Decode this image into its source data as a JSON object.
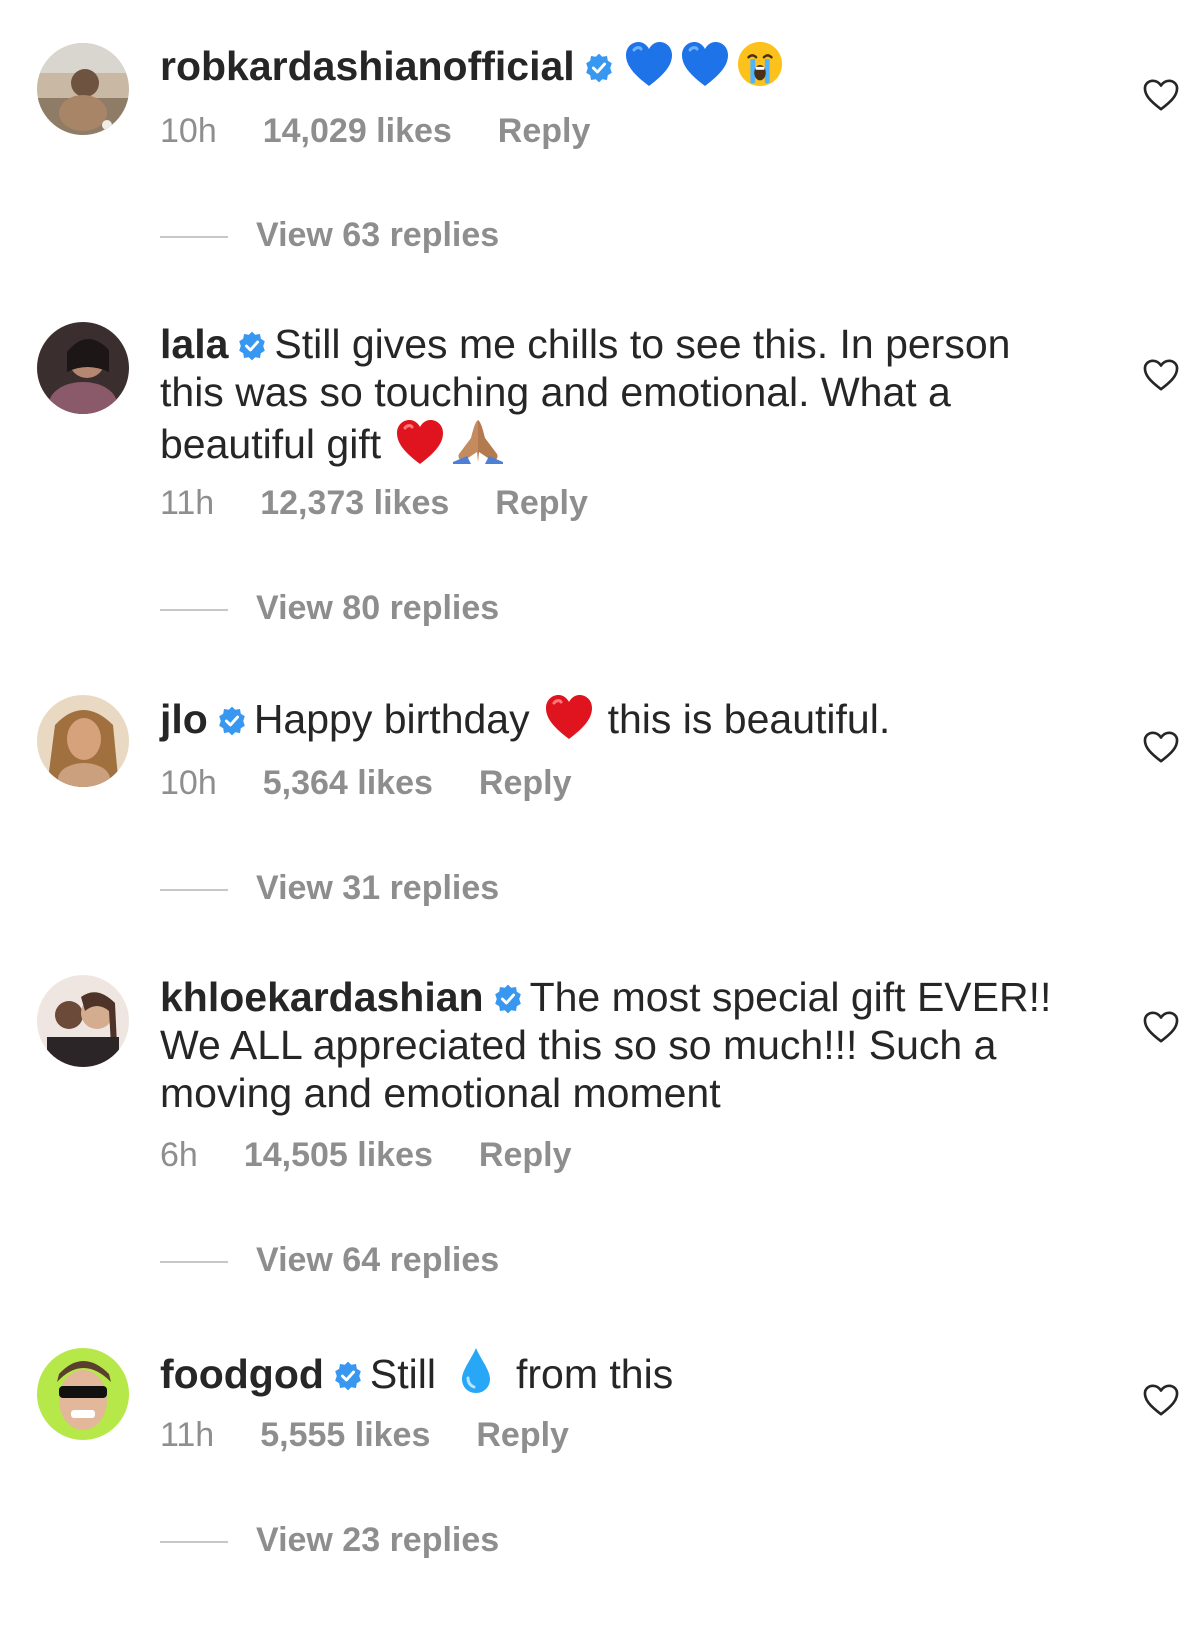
{
  "comments": [
    {
      "username": "robkardashianofficial",
      "text": "",
      "emoji": [
        "blue-heart",
        "blue-heart",
        "crying-face"
      ],
      "time": "10h",
      "likes": "14,029 likes",
      "reply": "Reply",
      "view_replies": "View 63 replies"
    },
    {
      "username": "lala",
      "text": "Still gives me chills to see this. In person this was so touching and emotional. What a beautiful gift",
      "emoji": [
        "red-heart",
        "folded-hands"
      ],
      "time": "11h",
      "likes": "12,373 likes",
      "reply": "Reply",
      "view_replies": "View 80 replies"
    },
    {
      "username": "jlo",
      "text_before": "Happy birthday",
      "emoji": [
        "red-heart"
      ],
      "text_after": "this is beautiful.",
      "time": "10h",
      "likes": "5,364 likes",
      "reply": "Reply",
      "view_replies": "View 31 replies"
    },
    {
      "username": "khloekardashian",
      "text": "The most special gift EVER!! We ALL appreciated this so so much!!! Such a moving and emotional moment",
      "time": "6h",
      "likes": "14,505 likes",
      "reply": "Reply",
      "view_replies": "View 64 replies"
    },
    {
      "username": "foodgod",
      "text_before": "Still",
      "emoji": [
        "droplet"
      ],
      "text_after": "from this",
      "time": "11h",
      "likes": "5,555 likes",
      "reply": "Reply",
      "view_replies": "View 23 replies"
    }
  ],
  "colors": {
    "text": "#262626",
    "meta": "#8e8e8e",
    "verified": "#3897f0",
    "divider": "#c7c7c7"
  }
}
